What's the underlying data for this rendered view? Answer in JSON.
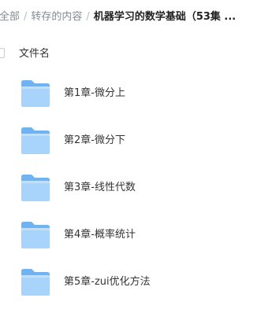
{
  "breadcrumb": {
    "items": [
      "全部",
      "转存的内容"
    ],
    "separator": "/",
    "current": "机器学习的数学基础（53集 ..."
  },
  "list_header": {
    "column_name": "文件名"
  },
  "files": [
    {
      "name": "第1章-微分上",
      "icon": "folder-icon"
    },
    {
      "name": "第2章-微分下",
      "icon": "folder-icon"
    },
    {
      "name": "第3章-线性代数",
      "icon": "folder-icon"
    },
    {
      "name": "第4章-概率统计",
      "icon": "folder-icon"
    },
    {
      "name": "第5章-zui优化方法",
      "icon": "folder-icon"
    }
  ],
  "colors": {
    "folder_light": "#a8d4fb",
    "folder_dark": "#6fb3f3",
    "text_muted": "#858a93"
  }
}
